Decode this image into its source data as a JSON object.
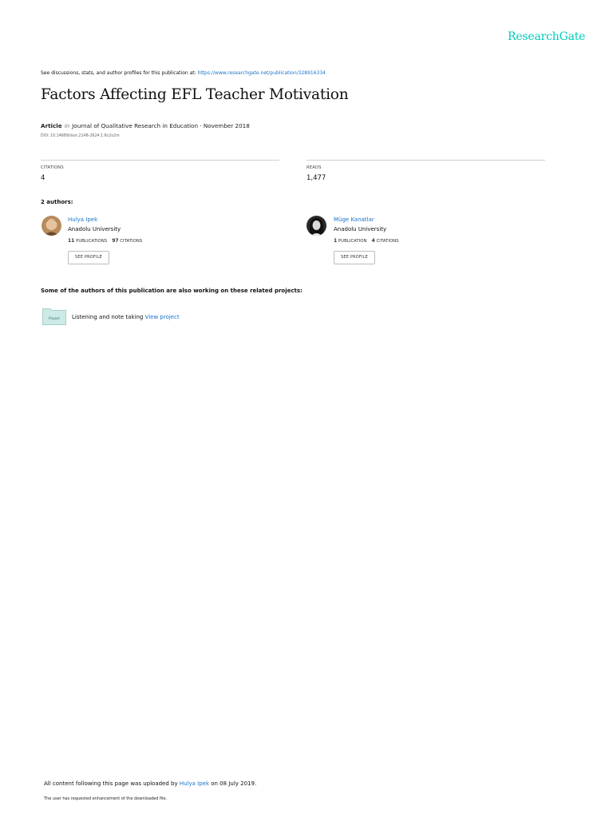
{
  "brand": {
    "logo": "ResearchGate"
  },
  "header": {
    "discuss_prefix": "See discussions, stats, and author profiles for this publication at: ",
    "discuss_url": "https://www.researchgate.net/publication/328916334"
  },
  "paper": {
    "title": "Factors Affecting EFL Teacher Motivation",
    "type": "Article",
    "in": "in",
    "journal_date": "Journal of Qualitative Research in Education · November 2018",
    "doi": "DOI: 10.14689/issn.2148-2624.1.6c2s2m"
  },
  "stats": {
    "citations_label": "CITATIONS",
    "citations_value": "4",
    "reads_label": "READS",
    "reads_value": "1,477"
  },
  "authors": {
    "heading": "2 authors:",
    "list": [
      {
        "name": "Hulya Ipek",
        "institution": "Anadolu University",
        "pubs_count": "11",
        "pubs_label": "PUBLICATIONS",
        "cit_count": "97",
        "cit_label": "CITATIONS",
        "button": "SEE PROFILE"
      },
      {
        "name": "Müge Kanatlar",
        "institution": "Anadolu University",
        "pubs_count": "1",
        "pubs_label": "PUBLICATION",
        "cit_count": "4",
        "cit_label": "CITATIONS",
        "button": "SEE PROFILE"
      }
    ]
  },
  "related": {
    "heading": "Some of the authors of this publication are also working on these related projects:",
    "project_badge": "Project",
    "project_name": "Listening and note taking",
    "project_link": "View project"
  },
  "footer": {
    "uploaded_prefix": "All content following this page was uploaded by ",
    "uploader": "Hulya Ipek",
    "uploaded_suffix": " on 08 July 2019.",
    "note": "The user has requested enhancement of the downloaded file."
  },
  "colors": {
    "brand": "#00ccbb",
    "link": "#1a73c9",
    "folder": "#cdeae6"
  }
}
